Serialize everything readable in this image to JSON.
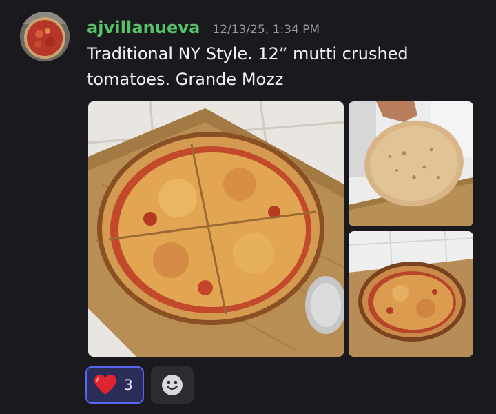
{
  "message": {
    "author": "ajvillanueva",
    "timestamp": "12/13/25, 1:34 PM",
    "content_lines": [
      "Traditional NY Style. 12” mutti crushed",
      "tomatoes. Grande Mozz"
    ]
  },
  "colors": {
    "username": "#57c26a",
    "background": "#1a1a1e",
    "reaction_active_border": "#5865f2",
    "reaction_active_bg": "#2a2d57"
  },
  "avatar": {
    "icon": "pizza-avatar-photo"
  },
  "attachments": [
    {
      "icon": "pizza-whole-sliced-photo"
    },
    {
      "icon": "pizza-crust-underside-photo"
    },
    {
      "icon": "pizza-whole-photo"
    }
  ],
  "reactions": [
    {
      "emoji_icon": "red-heart-emoji",
      "count": "3",
      "active": true
    }
  ],
  "add_reaction": {
    "icon": "smiley-face-icon"
  }
}
